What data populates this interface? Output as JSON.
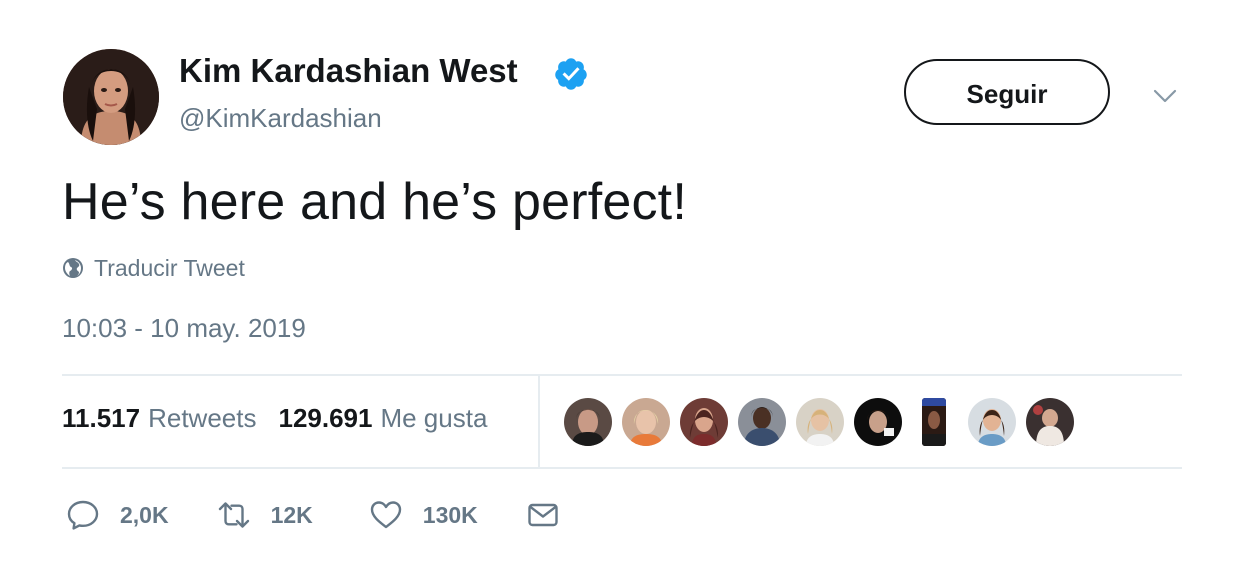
{
  "user": {
    "display_name": "Kim Kardashian West",
    "handle": "@KimKardashian",
    "verified": true,
    "avatar_icon": "profile-photo"
  },
  "header": {
    "follow_label": "Seguir",
    "menu_icon": "chevron-down-icon"
  },
  "tweet": {
    "text": "He’s here and he’s perfect!",
    "translate_label": "Traducir Tweet",
    "timestamp": "10:03 - 10 may. 2019"
  },
  "stats": {
    "retweets_count": "11.517",
    "retweets_label": "Retweets",
    "likes_count": "129.691",
    "likes_label": "Me gusta",
    "liker_avatars": 9
  },
  "actions": {
    "reply_count": "2,0K",
    "retweet_count": "12K",
    "like_count": "130K"
  },
  "colors": {
    "text_primary": "#14171a",
    "text_secondary": "#657786",
    "verified_blue": "#1da1f2",
    "divider": "#e6ecf0"
  }
}
